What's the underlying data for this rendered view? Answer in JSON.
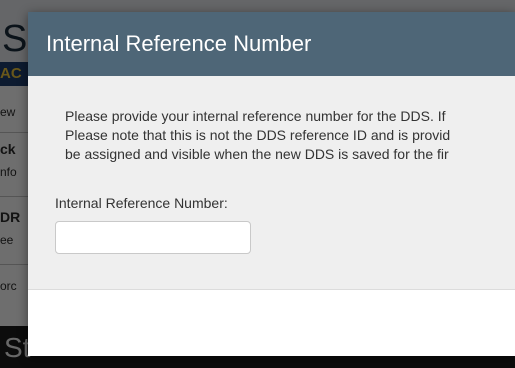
{
  "background": {
    "header_text": "S",
    "nav_text": "AC",
    "left_items": [
      "ew",
      "ck",
      "nfo",
      "DR",
      "ee",
      "orc"
    ],
    "footer_text": "St"
  },
  "modal": {
    "title": "Internal Reference Number",
    "body_lines": [
      "Please provide your internal reference number for the DDS. If",
      "Please note that this is not the DDS reference ID and is provid",
      "be assigned and visible when the new DDS is saved for the fir"
    ],
    "field_label": "Internal Reference Number:",
    "field_value": "",
    "field_placeholder": ""
  },
  "colors": {
    "modal_header": "#4e6677",
    "modal_body": "#efefef",
    "nav_strip": "#1d3d6b",
    "nav_accent": "#e9c23a"
  }
}
